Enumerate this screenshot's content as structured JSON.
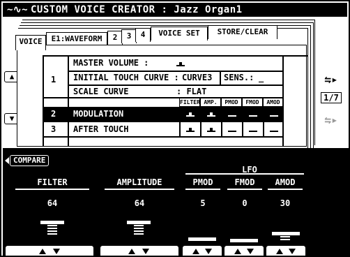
{
  "title": "CUSTOM VOICE CREATOR : Jazz Organ1",
  "tabs": {
    "voice": "VOICE",
    "e1": "E1:WAVEFORM",
    "t2": "2",
    "t3": "3",
    "t4": "4",
    "voice_set": "VOICE SET",
    "store": "STORE/CLEAR"
  },
  "panel": {
    "group1_number": "1",
    "master_volume_label": "MASTER VOLUME :",
    "initial_touch_label": "INITIAL TOUCH CURVE :",
    "initial_touch_value": "CURVE3",
    "sens_label": "SENS.:",
    "sens_value": "_",
    "scale_curve_label": "SCALE CURVE",
    "scale_curve_value": ": FLAT",
    "col_headers": [
      "FILTER",
      "AMP.",
      "PMOD",
      "FMOD",
      "AMOD"
    ],
    "rows": [
      {
        "number": "2",
        "label": "MODULATION",
        "cells": [
          "on",
          "on",
          "off",
          "off",
          "off"
        ],
        "selected": true
      },
      {
        "number": "3",
        "label": "AFTER TOUCH",
        "cells": [
          "on",
          "on",
          "off",
          "off",
          "off"
        ],
        "selected": false
      }
    ]
  },
  "side": {
    "page": "1/7"
  },
  "bottom": {
    "compare_label": "COMPARE",
    "lfo_label": "LFO",
    "params": [
      {
        "label": "FILTER",
        "value": "64",
        "level": 0.64
      },
      {
        "label": "AMPLITUDE",
        "value": "64",
        "level": 0.64
      },
      {
        "label": "PMOD",
        "value": "5",
        "level": 0.05
      },
      {
        "label": "FMOD",
        "value": "0",
        "level": 0.0
      },
      {
        "label": "AMOD",
        "value": "30",
        "level": 0.3
      }
    ]
  }
}
